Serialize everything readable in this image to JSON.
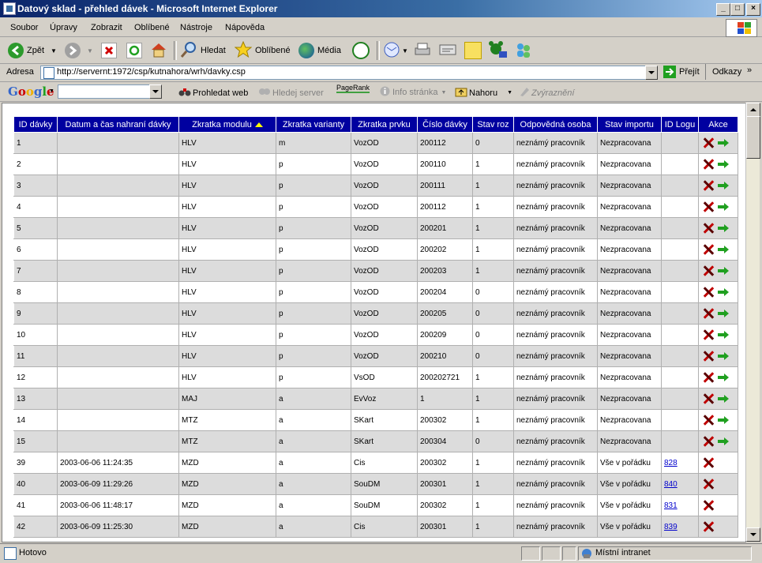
{
  "window": {
    "title": "Datový sklad - přehled dávek - Microsoft Internet Explorer"
  },
  "menu": [
    "Soubor",
    "Úpravy",
    "Zobrazit",
    "Oblíbené",
    "Nástroje",
    "Nápověda"
  ],
  "toolbar": {
    "back": "Zpět",
    "search": "Hledat",
    "favorites": "Oblíbené",
    "media": "Média"
  },
  "address": {
    "label": "Adresa",
    "url": "http://servernt:1972/csp/kutnahora/wrh/davky.csp",
    "go": "Přejít",
    "links": "Odkazy"
  },
  "googlebar": {
    "logo": "Google",
    "search_web": "Prohledat web",
    "search_server": "Hledej server",
    "pagerank": "PageRank",
    "info": "Info stránka",
    "up": "Nahoru",
    "highlight": "Zvýraznění"
  },
  "table": {
    "headers": [
      "ID dávky",
      "Datum a čas nahraní dávky",
      "Zkratka modulu",
      "Zkratka varianty",
      "Zkratka prvku",
      "Číslo dávky",
      "Stav roz",
      "Odpovědná osoba",
      "Stav importu",
      "ID Logu",
      "Akce"
    ],
    "rows": [
      {
        "id": "1",
        "date": "",
        "module": "HLV",
        "variant": "m",
        "element": "VozOD",
        "batch": "200112",
        "state": "0",
        "person": "neznámý pracovník",
        "import": "Nezpracovana",
        "log": "",
        "go": true
      },
      {
        "id": "2",
        "date": "",
        "module": "HLV",
        "variant": "p",
        "element": "VozOD",
        "batch": "200110",
        "state": "1",
        "person": "neznámý pracovník",
        "import": "Nezpracovana",
        "log": "",
        "go": true
      },
      {
        "id": "3",
        "date": "",
        "module": "HLV",
        "variant": "p",
        "element": "VozOD",
        "batch": "200111",
        "state": "1",
        "person": "neznámý pracovník",
        "import": "Nezpracovana",
        "log": "",
        "go": true
      },
      {
        "id": "4",
        "date": "",
        "module": "HLV",
        "variant": "p",
        "element": "VozOD",
        "batch": "200112",
        "state": "1",
        "person": "neznámý pracovník",
        "import": "Nezpracovana",
        "log": "",
        "go": true
      },
      {
        "id": "5",
        "date": "",
        "module": "HLV",
        "variant": "p",
        "element": "VozOD",
        "batch": "200201",
        "state": "1",
        "person": "neznámý pracovník",
        "import": "Nezpracovana",
        "log": "",
        "go": true
      },
      {
        "id": "6",
        "date": "",
        "module": "HLV",
        "variant": "p",
        "element": "VozOD",
        "batch": "200202",
        "state": "1",
        "person": "neznámý pracovník",
        "import": "Nezpracovana",
        "log": "",
        "go": true
      },
      {
        "id": "7",
        "date": "",
        "module": "HLV",
        "variant": "p",
        "element": "VozOD",
        "batch": "200203",
        "state": "1",
        "person": "neznámý pracovník",
        "import": "Nezpracovana",
        "log": "",
        "go": true
      },
      {
        "id": "8",
        "date": "",
        "module": "HLV",
        "variant": "p",
        "element": "VozOD",
        "batch": "200204",
        "state": "0",
        "person": "neznámý pracovník",
        "import": "Nezpracovana",
        "log": "",
        "go": true
      },
      {
        "id": "9",
        "date": "",
        "module": "HLV",
        "variant": "p",
        "element": "VozOD",
        "batch": "200205",
        "state": "0",
        "person": "neznámý pracovník",
        "import": "Nezpracovana",
        "log": "",
        "go": true
      },
      {
        "id": "10",
        "date": "",
        "module": "HLV",
        "variant": "p",
        "element": "VozOD",
        "batch": "200209",
        "state": "0",
        "person": "neznámý pracovník",
        "import": "Nezpracovana",
        "log": "",
        "go": true
      },
      {
        "id": "11",
        "date": "",
        "module": "HLV",
        "variant": "p",
        "element": "VozOD",
        "batch": "200210",
        "state": "0",
        "person": "neznámý pracovník",
        "import": "Nezpracovana",
        "log": "",
        "go": true
      },
      {
        "id": "12",
        "date": "",
        "module": "HLV",
        "variant": "p",
        "element": "VsOD",
        "batch": "200202721",
        "state": "1",
        "person": "neznámý pracovník",
        "import": "Nezpracovana",
        "log": "",
        "go": true
      },
      {
        "id": "13",
        "date": "",
        "module": "MAJ",
        "variant": "a",
        "element": "EvVoz",
        "batch": "1",
        "state": "1",
        "person": "neznámý pracovník",
        "import": "Nezpracovana",
        "log": "",
        "go": true
      },
      {
        "id": "14",
        "date": "",
        "module": "MTZ",
        "variant": "a",
        "element": "SKart",
        "batch": "200302",
        "state": "1",
        "person": "neznámý pracovník",
        "import": "Nezpracovana",
        "log": "",
        "go": true
      },
      {
        "id": "15",
        "date": "",
        "module": "MTZ",
        "variant": "a",
        "element": "SKart",
        "batch": "200304",
        "state": "0",
        "person": "neznámý pracovník",
        "import": "Nezpracovana",
        "log": "",
        "go": true
      },
      {
        "id": "39",
        "date": "2003-06-06 11:24:35",
        "module": "MZD",
        "variant": "a",
        "element": "Cis",
        "batch": "200302",
        "state": "1",
        "person": "neznámý pracovník",
        "import": "Vše v pořádku",
        "log": "828",
        "go": false
      },
      {
        "id": "40",
        "date": "2003-06-09 11:29:26",
        "module": "MZD",
        "variant": "a",
        "element": "SouDM",
        "batch": "200301",
        "state": "1",
        "person": "neznámý pracovník",
        "import": "Vše v pořádku",
        "log": "840",
        "go": false
      },
      {
        "id": "41",
        "date": "2003-06-06 11:48:17",
        "module": "MZD",
        "variant": "a",
        "element": "SouDM",
        "batch": "200302",
        "state": "1",
        "person": "neznámý pracovník",
        "import": "Vše v pořádku",
        "log": "831",
        "go": false
      },
      {
        "id": "42",
        "date": "2003-06-09 11:25:30",
        "module": "MZD",
        "variant": "a",
        "element": "Cis",
        "batch": "200301",
        "state": "1",
        "person": "neznámý pracovník",
        "import": "Vše v pořádku",
        "log": "839",
        "go": false
      }
    ]
  },
  "status": {
    "text": "Hotovo",
    "zone": "Místní intranet"
  }
}
